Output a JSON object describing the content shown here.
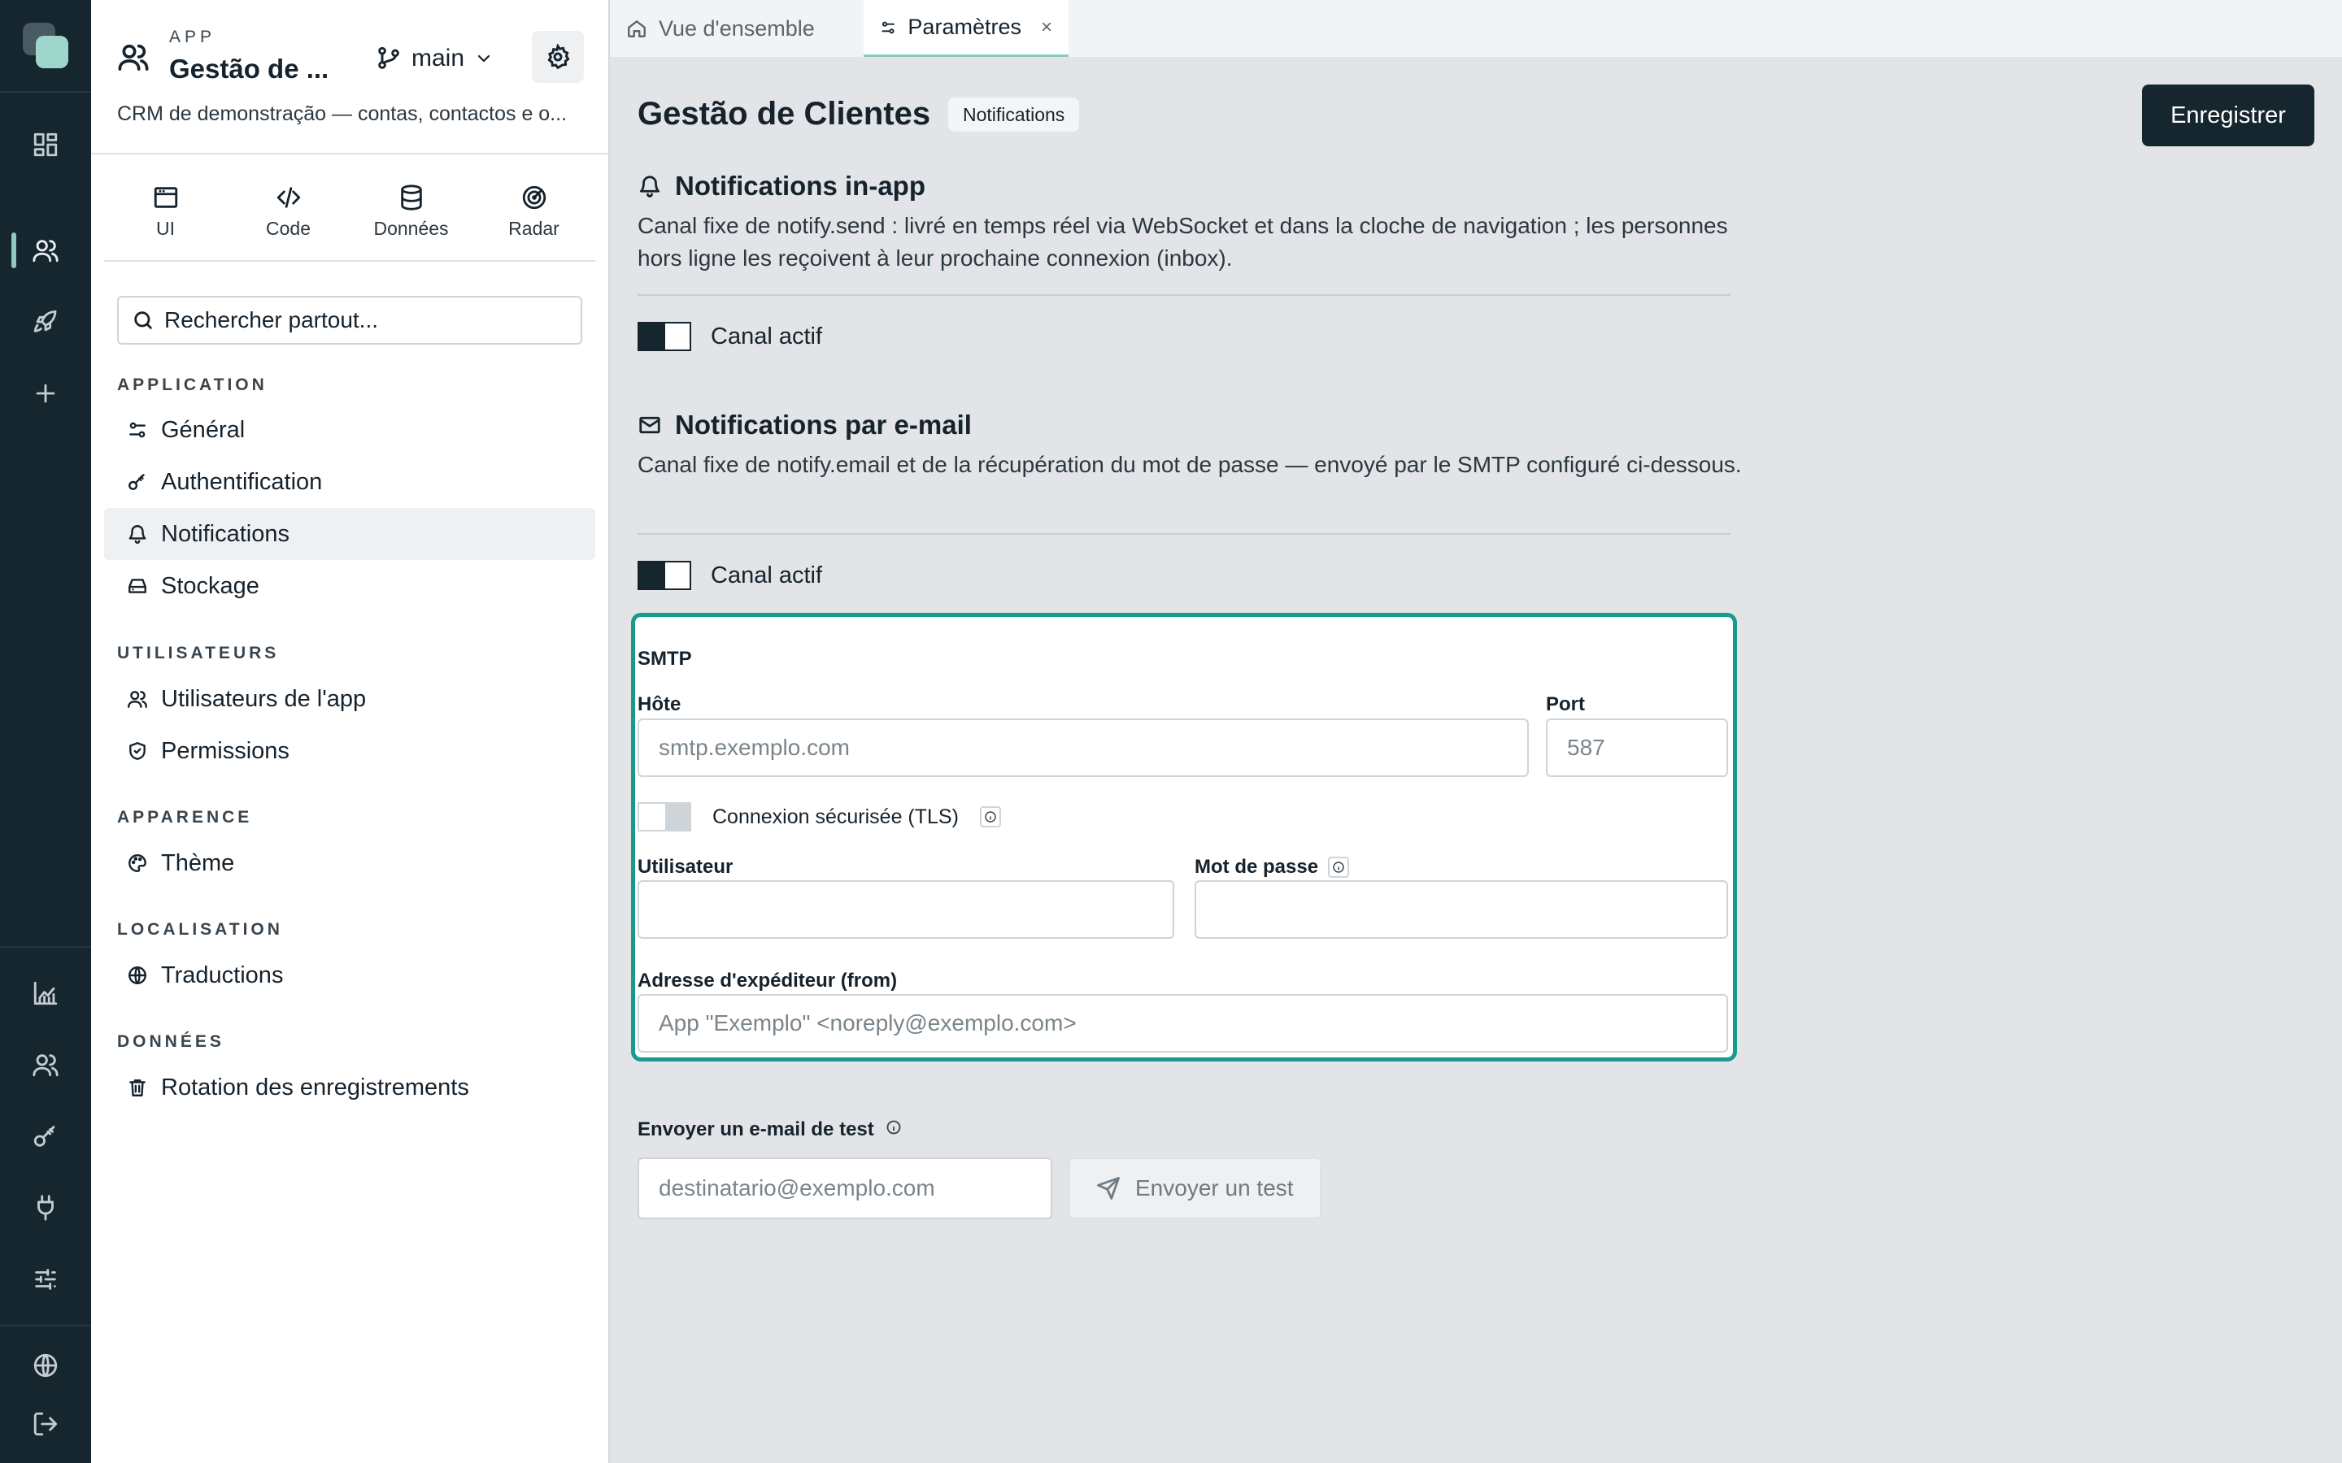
{
  "sidebar": {
    "kicker": "APP",
    "app_name": "Gestão de ...",
    "branch": "main",
    "description": "CRM de demonstração — contas, contactos e o...",
    "tabs": [
      {
        "label": "UI",
        "icon": "window-icon"
      },
      {
        "label": "Code",
        "icon": "code-icon"
      },
      {
        "label": "Données",
        "icon": "database-icon"
      },
      {
        "label": "Radar",
        "icon": "radar-icon"
      }
    ],
    "search_placeholder": "Rechercher partout...",
    "sections": {
      "application": "APPLICATION",
      "utilisateurs": "UTILISATEURS",
      "apparence": "APPARENCE",
      "localisation": "LOCALISATION",
      "donnees": "DONNÉES"
    },
    "items": {
      "general": "Général",
      "auth": "Authentification",
      "notifications": "Notifications",
      "stockage": "Stockage",
      "app_users": "Utilisateurs de l'app",
      "permissions": "Permissions",
      "theme": "Thème",
      "traductions": "Traductions",
      "rotation": "Rotation des enregistrements"
    }
  },
  "tabs": {
    "overview": "Vue d'ensemble",
    "settings": "Paramètres",
    "close": "×"
  },
  "page": {
    "title": "Gestão de Clientes",
    "badge": "Notifications",
    "save_label": "Enregistrer"
  },
  "inapp": {
    "title": "Notifications in-app",
    "desc": "Canal fixe de notify.send : livré en temps réel via WebSocket et dans la cloche de navigation ; les personnes hors ligne les reçoivent à leur prochaine connexion (inbox).",
    "toggle_label": "Canal actif"
  },
  "email": {
    "title": "Notifications par e-mail",
    "desc": "Canal fixe de notify.email et de la récupération du mot de passe — envoyé par le SMTP configuré ci-dessous.",
    "toggle_label": "Canal actif"
  },
  "smtp": {
    "heading": "SMTP",
    "host_label": "Hôte",
    "host_placeholder": "smtp.exemplo.com",
    "port_label": "Port",
    "port_placeholder": "587",
    "tls_label": "Connexion sécurisée (TLS)",
    "user_label": "Utilisateur",
    "user_value": "",
    "password_label": "Mot de passe",
    "password_value": "",
    "from_label": "Adresse d'expéditeur (from)",
    "from_placeholder": "App \"Exemplo\" <noreply@exemplo.com>"
  },
  "test": {
    "label": "Envoyer un e-mail de test",
    "recipient_placeholder": "destinatario@exemplo.com",
    "button_label": "Envoyer un test"
  },
  "colors": {
    "rail_bg": "#16262f",
    "accent": "#159a8c",
    "primary_button": "#16262f"
  }
}
